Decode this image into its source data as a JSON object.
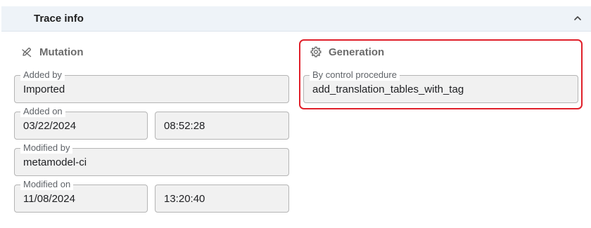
{
  "panel": {
    "title": "Trace info"
  },
  "mutation": {
    "title": "Mutation",
    "icon": "pencil-slash-icon",
    "added_by": {
      "label": "Added by",
      "value": "Imported"
    },
    "added_on": {
      "label": "Added on",
      "date": "03/22/2024",
      "time": "08:52:28"
    },
    "modified_by": {
      "label": "Modified by",
      "value": "metamodel-ci"
    },
    "modified_on": {
      "label": "Modified on",
      "date": "11/08/2024",
      "time": "13:20:40"
    }
  },
  "generation": {
    "title": "Generation",
    "icon": "gear-icon",
    "by_control_procedure": {
      "label": "By control procedure",
      "value": "add_translation_tables_with_tag"
    }
  },
  "colors": {
    "header_bg": "#eef3f8",
    "field_bg": "#f1f1f1",
    "highlight": "#e0202a"
  }
}
